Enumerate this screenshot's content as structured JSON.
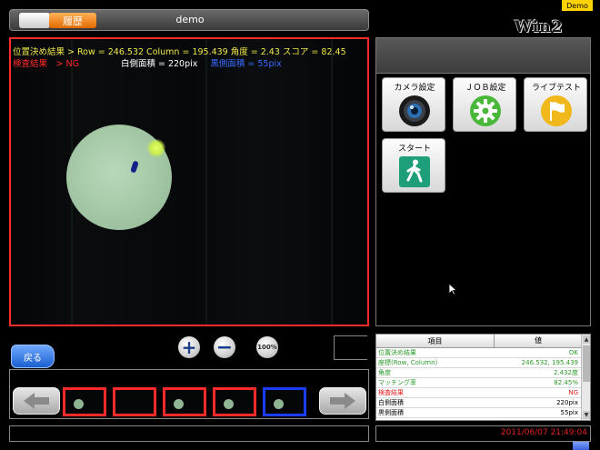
{
  "window": {
    "title": "demo",
    "history_label": "履歴",
    "demo_badge": "Demo",
    "brand": "Win2 MV"
  },
  "overlay": {
    "position_result": "位置決め結果 > Row = 246.532 Column = 195.439 角度 = 2.43 スコア = 82.45",
    "inspection_result": "検査結果　> NG",
    "white_area": "白側面積 = 220pix",
    "black_area": "黒側面積 = 55pix"
  },
  "controls": {
    "zoom_in_glyph": "+",
    "zoom_out_glyph": "−",
    "zoom_100_label": "100%",
    "back_label": "戻る"
  },
  "thumbnails": [
    {
      "status": "NG",
      "has_specimen": true
    },
    {
      "status": "NG",
      "has_specimen": false
    },
    {
      "status": "NG",
      "has_specimen": true
    },
    {
      "status": "NG",
      "has_specimen": true
    },
    {
      "status": "selected",
      "has_specimen": true
    }
  ],
  "function_buttons": {
    "camera": {
      "label": "カメラ設定",
      "icon": "camera-lens-icon"
    },
    "job": {
      "label": "ＪＯＢ設定",
      "icon": "gear-icon"
    },
    "live_test": {
      "label": "ライブテスト",
      "icon": "flag-icon"
    },
    "start": {
      "label": "スタート",
      "icon": "walking-person-icon"
    }
  },
  "results": {
    "headers": [
      "項目",
      "値"
    ],
    "rows": [
      {
        "item": "位置決め結果",
        "value": "OK",
        "color": "#2a9a2a"
      },
      {
        "item": "座標(Row, Column)",
        "value": "246.532, 195.439",
        "color": "#2a9a2a"
      },
      {
        "item": "角度",
        "value": "2.432度",
        "color": "#2a9a2a"
      },
      {
        "item": "マッチング率",
        "value": "82.45%",
        "color": "#2a9a2a"
      },
      {
        "item": "検査結果",
        "value": "NG",
        "color": "#e02020"
      },
      {
        "item": "白側面積",
        "value": "220pix",
        "color": "#000000"
      },
      {
        "item": "黒側面積",
        "value": "55pix",
        "color": "#000000"
      }
    ]
  },
  "status": {
    "timestamp": "2011/06/07 21:49:04"
  },
  "colors": {
    "ng_border": "#ff2a2a",
    "selected_border": "#1a3dff",
    "accent_orange": "#f07a10"
  }
}
